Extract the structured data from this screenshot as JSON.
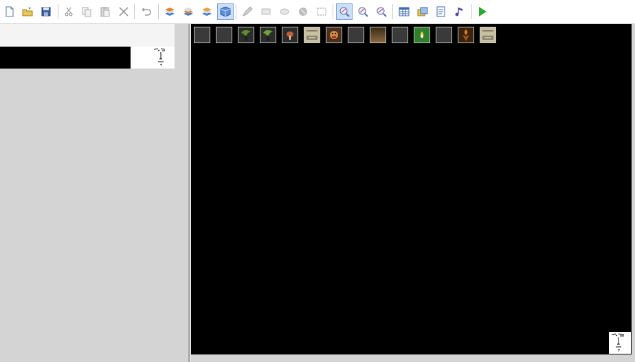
{
  "toolbar": {
    "buttons": [
      {
        "id": "new",
        "icon": "new-file-icon"
      },
      {
        "id": "open",
        "icon": "open-folder-icon"
      },
      {
        "id": "save",
        "icon": "save-disk-icon"
      },
      {
        "id": "cut",
        "icon": "scissors-icon"
      },
      {
        "id": "copy",
        "icon": "copy-icon"
      },
      {
        "id": "paste",
        "icon": "paste-icon"
      },
      {
        "id": "delete",
        "icon": "delete-x-icon"
      },
      {
        "id": "undo",
        "icon": "undo-icon"
      },
      {
        "id": "layer1",
        "icon": "layer-lower-icon"
      },
      {
        "id": "layer2",
        "icon": "layer-middle-icon"
      },
      {
        "id": "layer3",
        "icon": "layer-upper-icon"
      },
      {
        "id": "event-layer",
        "icon": "event-layer-cube-icon",
        "active": true
      },
      {
        "id": "pencil",
        "icon": "pencil-icon"
      },
      {
        "id": "rectangle",
        "icon": "rectangle-icon"
      },
      {
        "id": "ellipse",
        "icon": "ellipse-icon"
      },
      {
        "id": "fill",
        "icon": "fill-bucket-icon"
      },
      {
        "id": "select",
        "icon": "selection-icon"
      },
      {
        "id": "zoom-1",
        "icon": "zoom-1-1-icon",
        "active": true
      },
      {
        "id": "zoom-2",
        "icon": "zoom-1-2-icon"
      },
      {
        "id": "zoom-4",
        "icon": "zoom-1-4-icon"
      },
      {
        "id": "database",
        "icon": "database-icon"
      },
      {
        "id": "resources",
        "icon": "resource-manager-icon"
      },
      {
        "id": "script",
        "icon": "script-editor-icon"
      },
      {
        "id": "sound",
        "icon": "sound-test-icon"
      },
      {
        "id": "play",
        "icon": "play-test-icon"
      }
    ]
  },
  "map": {
    "events": [
      {
        "kind": "empty"
      },
      {
        "kind": "empty"
      },
      {
        "kind": "plant",
        "color": "#5a8f2a"
      },
      {
        "kind": "plant",
        "color": "#6aa532"
      },
      {
        "kind": "mushroom",
        "color": "#c06030"
      },
      {
        "kind": "sign",
        "color": "#c8bfa0"
      },
      {
        "kind": "face",
        "color": "#d08a3a"
      },
      {
        "kind": "empty"
      },
      {
        "kind": "gradient",
        "color": "#8a6a40"
      },
      {
        "kind": "empty"
      },
      {
        "kind": "flame",
        "color": "#2f7f2f"
      },
      {
        "kind": "empty"
      },
      {
        "kind": "torch",
        "color": "#a05020"
      },
      {
        "kind": "sign",
        "color": "#c8bfa0"
      }
    ]
  },
  "colors": {
    "map_bg": "#000000",
    "panel_bg": "#d4d4d4",
    "active_button": "#c9e0f7"
  }
}
